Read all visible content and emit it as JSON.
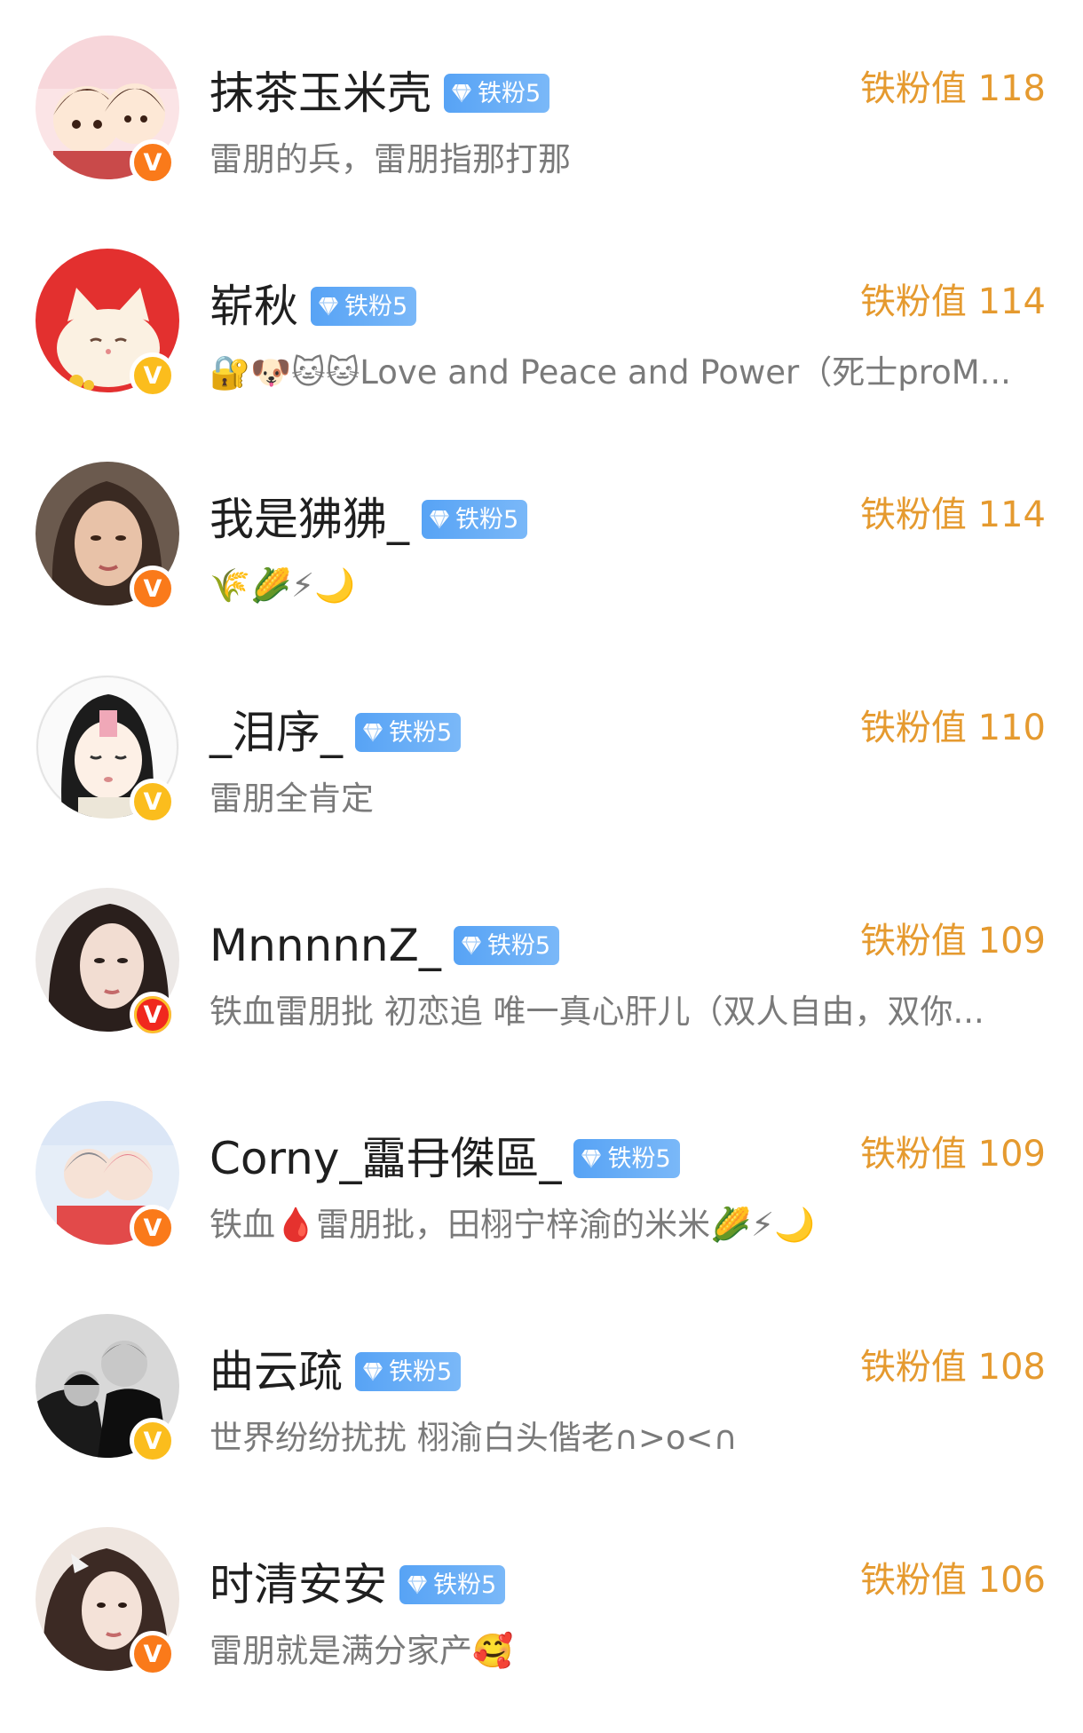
{
  "fan_badge_label": "铁粉5",
  "users": [
    {
      "name": "抹茶玉米壳",
      "fan_value": "铁粉值 118",
      "desc": "雷朋的兵，雷朋指那打那",
      "verify_color": "orange"
    },
    {
      "name": "崭秋",
      "fan_value": "铁粉值 114",
      "desc": "🔐🐶🐱🐱Love and Peace and Power（死士proM...",
      "verify_color": "yellow"
    },
    {
      "name": "我是狒狒_",
      "fan_value": "铁粉值 114",
      "desc": "🌾🌽⚡🌙",
      "verify_color": "orange"
    },
    {
      "name": "_泪序_",
      "fan_value": "铁粉值 110",
      "desc": "雷朋全肯定",
      "verify_color": "yellow"
    },
    {
      "name": "MnnnnnZ_",
      "fan_value": "铁粉值 109",
      "desc": "铁血雷朋批 初恋追 唯一真心肝儿（双人自由，双你...",
      "verify_color": "red"
    },
    {
      "name": "Corny_靁冄傑區_",
      "fan_value": "铁粉值 109",
      "desc": "铁血🩸雷朋批，田栩宁梓渝的米米🌽⚡🌙",
      "verify_color": "orange"
    },
    {
      "name": "曲云疏",
      "fan_value": "铁粉值 108",
      "desc": "世界纷纷扰扰 栩渝白头偕老∩>o<∩",
      "verify_color": "yellow"
    },
    {
      "name": "时清安安",
      "fan_value": "铁粉值 106",
      "desc": "雷朋就是满分家产🥰",
      "verify_color": "orange"
    }
  ],
  "colors": {
    "fan_value": "#e59a2f",
    "badge_blue": "#57a3f5",
    "name": "#1f1f1f",
    "desc": "#7a7a7a"
  }
}
